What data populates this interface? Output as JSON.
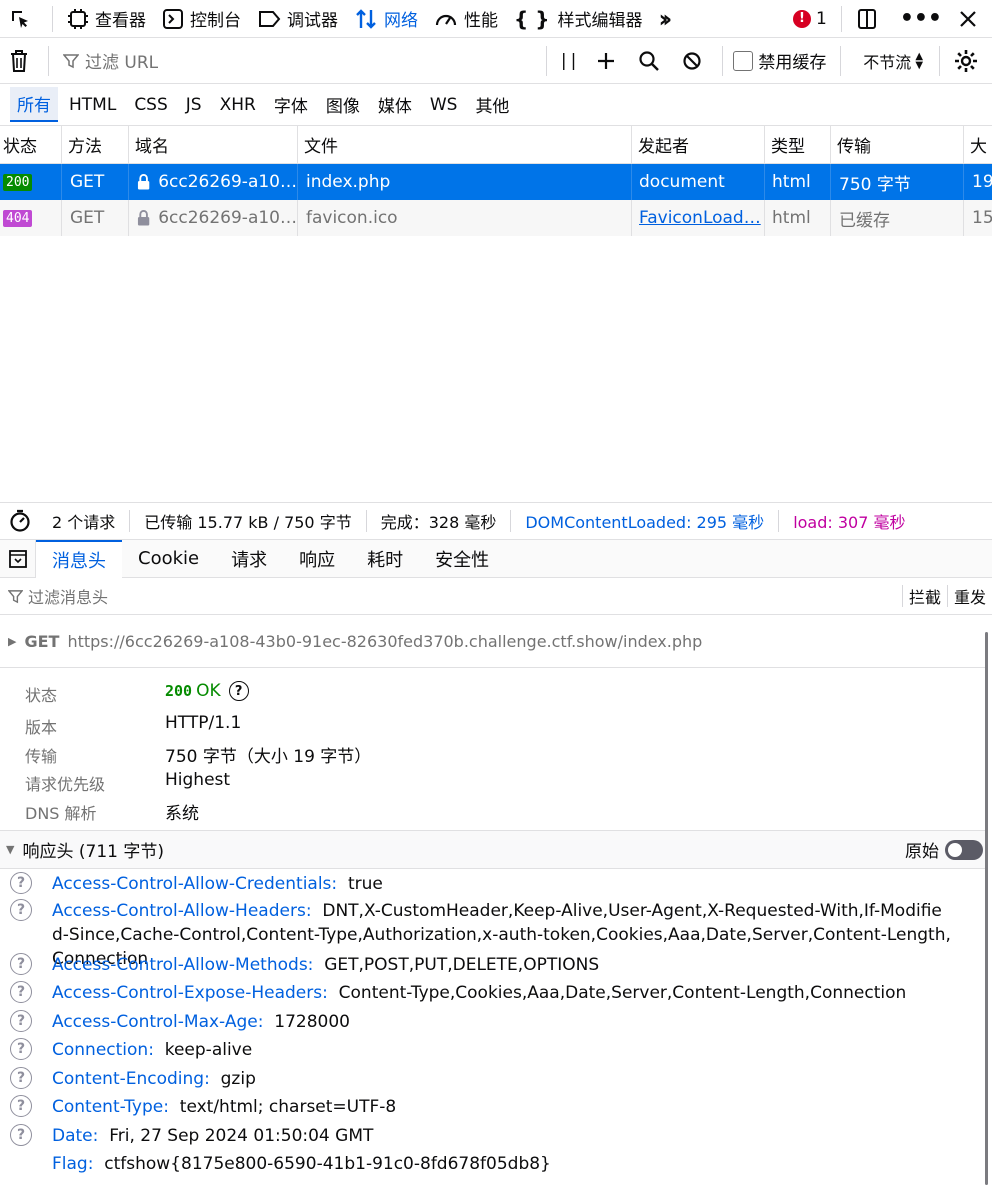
{
  "toolbar": {
    "inspector": "查看器",
    "console": "控制台",
    "debugger": "调试器",
    "network": "网络",
    "performance": "性能",
    "style_editor": "样式编辑器",
    "error_count": "1"
  },
  "filter": {
    "placeholder": "过滤 URL",
    "disable_cache": "禁用缓存",
    "throttling": "不节流"
  },
  "type_tabs": [
    "所有",
    "HTML",
    "CSS",
    "JS",
    "XHR",
    "字体",
    "图像",
    "媒体",
    "WS",
    "其他"
  ],
  "columns": {
    "status": "状态",
    "method": "方法",
    "domain": "域名",
    "file": "文件",
    "initiator": "发起者",
    "type": "类型",
    "transferred": "传输",
    "size": "大"
  },
  "requests": [
    {
      "status": "200",
      "method": "GET",
      "domain": "6cc26269-a10…",
      "file": "index.php",
      "initiator": "document",
      "type": "html",
      "transferred": "750 字节",
      "size": "19"
    },
    {
      "status": "404",
      "method": "GET",
      "domain": "6cc26269-a10…",
      "file": "favicon.ico",
      "initiator": "FaviconLoad…",
      "type": "html",
      "transferred": "已缓存",
      "size": "15"
    }
  ],
  "summary": {
    "requests": "2 个请求",
    "transferred": "已传输 15.77 kB / 750 字节",
    "finish": "完成：328 毫秒",
    "dcl": "DOMContentLoaded: 295 毫秒",
    "load": "load: 307 毫秒"
  },
  "detail_tabs": [
    "消息头",
    "Cookie",
    "请求",
    "响应",
    "耗时",
    "安全性"
  ],
  "header_filter": {
    "placeholder": "过滤消息头",
    "block": "拦截",
    "resend": "重发"
  },
  "request_line": {
    "method": "GET",
    "url": "https://6cc26269-a108-43b0-91ec-82630fed370b.challenge.ctf.show/index.php"
  },
  "summary_fields": {
    "status_label": "状态",
    "status_code": "200",
    "status_text": "OK",
    "version_label": "版本",
    "version_value": "HTTP/1.1",
    "transfer_label": "传输",
    "transfer_value": "750 字节（大小 19 字节）",
    "priority_label": "请求优先级",
    "priority_value": "Highest",
    "dns_label": "DNS 解析",
    "dns_value": "系统"
  },
  "response_headers": {
    "title": "响应头 (711 字节)",
    "raw_label": "原始",
    "items": [
      {
        "name": "Access-Control-Allow-Credentials:",
        "value": "true"
      },
      {
        "name": "Access-Control-Allow-Headers:",
        "value": "DNT,X-CustomHeader,Keep-Alive,User-Agent,X-Requested-With,If-Modified-Since,Cache-Control,Content-Type,Authorization,x-auth-token,Cookies,Aaa,Date,Server,Content-Length,Connection"
      },
      {
        "name": "Access-Control-Allow-Methods:",
        "value": "GET,POST,PUT,DELETE,OPTIONS"
      },
      {
        "name": "Access-Control-Expose-Headers:",
        "value": "Content-Type,Cookies,Aaa,Date,Server,Content-Length,Connection"
      },
      {
        "name": "Access-Control-Max-Age:",
        "value": "1728000"
      },
      {
        "name": "Connection:",
        "value": "keep-alive"
      },
      {
        "name": "Content-Encoding:",
        "value": "gzip"
      },
      {
        "name": "Content-Type:",
        "value": "text/html; charset=UTF-8"
      },
      {
        "name": "Date:",
        "value": "Fri, 27 Sep 2024 01:50:04 GMT"
      },
      {
        "name": "Flag:",
        "value": "ctfshow{8175e800-6590-41b1-91c0-8fd678f05db8}"
      }
    ]
  },
  "colors": {
    "accent": "#0060df",
    "selected_row": "#0074e8",
    "status_ok": "#058b00",
    "status_404": "#c04ad3",
    "dcl": "#0060df",
    "load": "#c000a0",
    "error": "#d70022"
  }
}
